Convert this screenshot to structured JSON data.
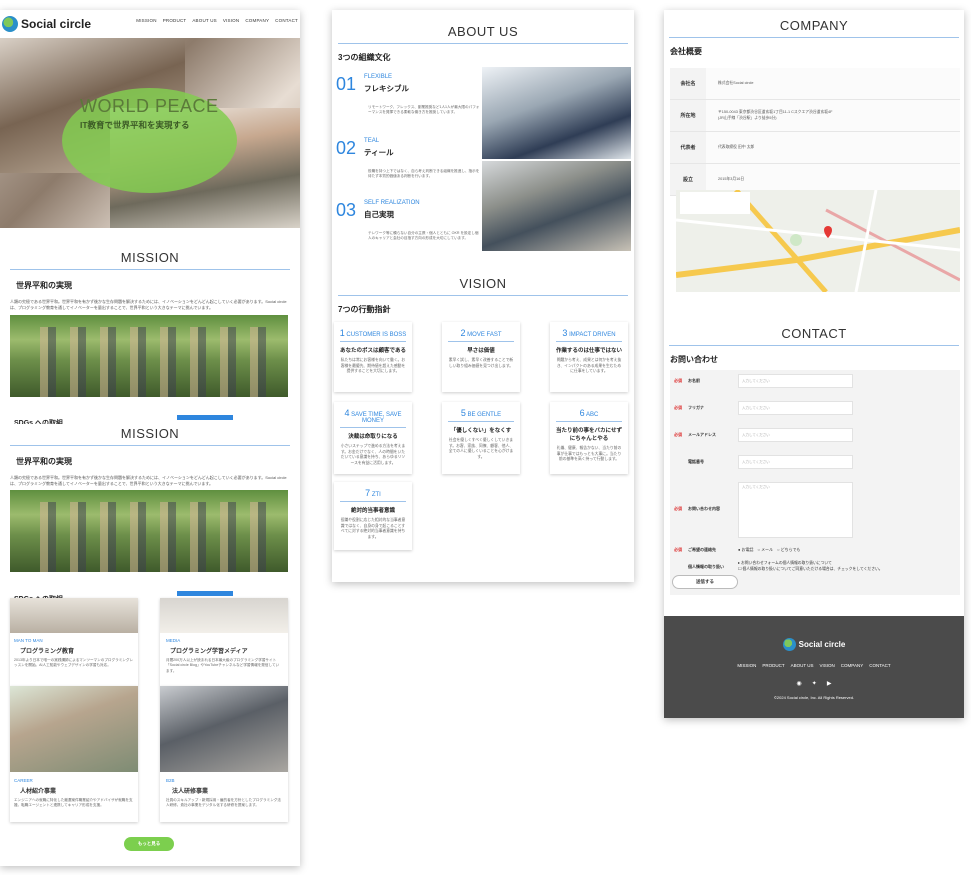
{
  "p1": {
    "logo": "Social circle",
    "nav": [
      "MISSION",
      "PRODUCT",
      "ABOUT US",
      "VISION",
      "COMPANY",
      "CONTACT"
    ],
    "hero_title": "WORLD PEACE",
    "hero_sub": "IT教育で世界平和を実現する",
    "mission_title": "MISSION",
    "mission_sub": "世界平和の実現",
    "mission_text": "人類の究極である世界平和。世界平和を有かず後かな生存問題を解決するためには、イノベーションをどんどん起こしていく必要があります。Social circleは、プログラミング教育を通してイノベーターを量出することで、世界平和という大きなテーマに挑んでいます。",
    "sdgs_cut": "SDGs への取組",
    "products": [
      {
        "tag": "MAN TO MAN",
        "title": "プログラミング教育",
        "text": "2013年より日本で唯一の実践講師によるマンツーマンのプログラミングレッスンを開始。AI人工知能やウェブデザインの学習も対応。"
      },
      {
        "tag": "MEDIA",
        "title": "プログラミング学習メディア",
        "text": "月間200万人以上が読まれる日本最大級のプログラミング学習サイト「Social circle Blog」やYouTubeチャンネルなど学習情報を発信しています。"
      },
      {
        "tag": "CAREER",
        "title": "人材紹介事業",
        "text": "エンジニアへの就職に特化した厳選案件職業紹介やアドバイザが就職を支援。転職エージェントと連携してキャリア形成を支援。"
      },
      {
        "tag": "B2B",
        "title": "法人研修事業",
        "text": "社員のスキルアップ・新規採用・雇的者を方針としたプログラミング法人研修。貴社の事業をデジタル化する研修を提案します。"
      }
    ],
    "more": "もっと見る"
  },
  "p2": {
    "about_title": "ABOUT US",
    "culture_sub": "3つの組織文化",
    "cultures": [
      {
        "num": "01",
        "kw": "FLEXIBLE",
        "jp": "フレキシブル",
        "text": "リモートワーク、フレックス、副業推奨など1人1人が最大限のパフォーマンスを発揮できる柔軟な働き方を推奨しています。"
      },
      {
        "num": "02",
        "kw": "TEAL",
        "jp": "ティール",
        "text": "役職を持つ上下ではなく、自ら考え判断できる組織を推進し、指示を待たず本質的価値ある判断を行います。"
      },
      {
        "num": "03",
        "kw": "SELF REALIZATION",
        "jp": "自己実現",
        "text": "テレワーク等に頼らない自分の主張・個人とともに OKR を設定し個人のキャリアと会社の目指す方向の形成を大切にしています。"
      }
    ],
    "vision_title": "VISION",
    "vision_sub": "7つの行動指針",
    "values": [
      {
        "n": "1",
        "kw": "CUSTOMER IS BOSS",
        "t": "あなたのボスは顧客である",
        "d": "私たちは常にお客様を向いて働く。お客様を最優先、期待値を超えた感動を提供することを大切にします。"
      },
      {
        "n": "2",
        "kw": "MOVE FAST",
        "t": "早さは価値",
        "d": "素早く試し、素早く改善することで新しい取り組み価値を見つけ出します。"
      },
      {
        "n": "3",
        "kw": "IMPACT DRIVEN",
        "t": "作業するのは仕事ではない",
        "d": "問題から考え、成果とは何かを考え抜き、インパクトのある成果を生むために仕事をしています。"
      },
      {
        "n": "4",
        "kw": "SAVE TIME, SAVE MONEY",
        "t": "決裁は命取りになる",
        "d": "小さいステップで進める方法を考えます。お金だけでなく、人の時間をいただいている意識を持ち、あらゆるリソースを有益に活用します。"
      },
      {
        "n": "5",
        "kw": "BE GENTLE",
        "t": "「優しくない」をなくす",
        "d": "社会を優しくすべく優しくしていきます。お客、家族、同僚、顧客、他人、全ての人に優しくいることを心がけます。"
      },
      {
        "n": "6",
        "kw": "ABC",
        "t": "当たり前の事をバカにせずにちゃんとやる",
        "d": "礼儀、健康、報告かない、当たり前の事が仕事ではもっとも大事に。当たり前の基準を高く持って行動します。"
      },
      {
        "n": "7",
        "kw": "ZTI",
        "t": "絶対的当事者意識",
        "d": "役職や役割に応じた相対的な当事者意識ではなく、自身の身で起こることすべてに対する絶対的当事者意識を持ちます。"
      }
    ]
  },
  "p3": {
    "company_title": "COMPANY",
    "company_sub": "会社概要",
    "rows": [
      {
        "k": "会社名",
        "v": "株式会社Social circle"
      },
      {
        "k": "所在地",
        "v": "〒150-0043 東京都渋谷区道玄坂1丁目11-1 Cスクエア渋谷道玄坂4F\n(JR山手線「渋谷駅」より徒歩5分)"
      },
      {
        "k": "代表者",
        "v": "代表取締役 田中 太郎"
      },
      {
        "k": "設立",
        "v": "2015年3月16日"
      }
    ],
    "contact_title": "CONTACT",
    "contact_sub": "お問い合わせ",
    "required": "必須",
    "fields": [
      {
        "label": "お名前",
        "ph": "入力してください",
        "req": true
      },
      {
        "label": "フリガナ",
        "ph": "入力してください",
        "req": true
      },
      {
        "label": "メールアドレス",
        "ph": "入力してください",
        "req": true
      },
      {
        "label": "電話番号",
        "ph": "入力してください",
        "req": false
      }
    ],
    "inquiry_label": "お問い合わせ内容",
    "inquiry_ph": "入力してください",
    "contact_method_label": "ご希望の連絡先",
    "radio": [
      "お電話",
      "メール",
      "どちらでも"
    ],
    "privacy_label": "個人情報の取り扱い",
    "privacy_text1": "お問い合わせフォームの個人情報の取り扱いについて",
    "privacy_text2": "個人情報の取り扱いについてご同意いただける場合は、チェックをしてください。",
    "submit": "送信する",
    "footer_logo": "Social circle",
    "footer_nav": [
      "MISSION",
      "PRODUCT",
      "ABOUT US",
      "VISION",
      "COMPANY",
      "CONTACT"
    ],
    "copyright": "©2024 Social circle, Inc. All Rights Reserved."
  }
}
